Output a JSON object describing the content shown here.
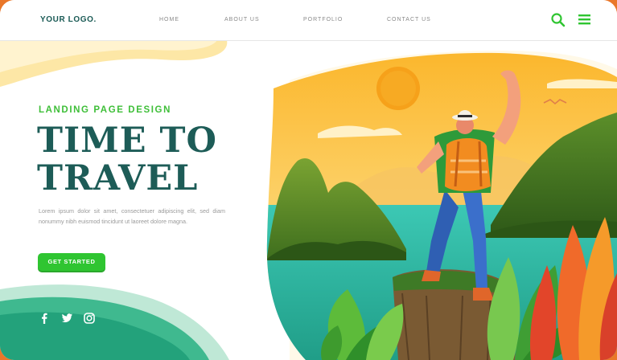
{
  "nav": {
    "logo": "YOUR LOGO.",
    "links": [
      "HOME",
      "ABOUT US",
      "PORTFOLIO",
      "CONTACT US"
    ],
    "icons": [
      "search-icon",
      "menu-icon"
    ]
  },
  "hero": {
    "kicker": "LANDING PAGE DESIGN",
    "headline_line1": "TIME TO",
    "headline_line2": "TRAVEL",
    "body": "Lorem ipsum dolor sit amet, consectetuer adipiscing elit, sed diam nonummy nibh euismod tincidunt ut laoreet dolore magna.",
    "cta_label": "GET STARTED"
  },
  "social": [
    "facebook-icon",
    "twitter-icon",
    "instagram-icon"
  ],
  "colors": {
    "brand_green": "#2fc531",
    "headline_teal": "#1d5c57",
    "sun": "#f6a11a",
    "accent_orange": "#e9772a"
  }
}
